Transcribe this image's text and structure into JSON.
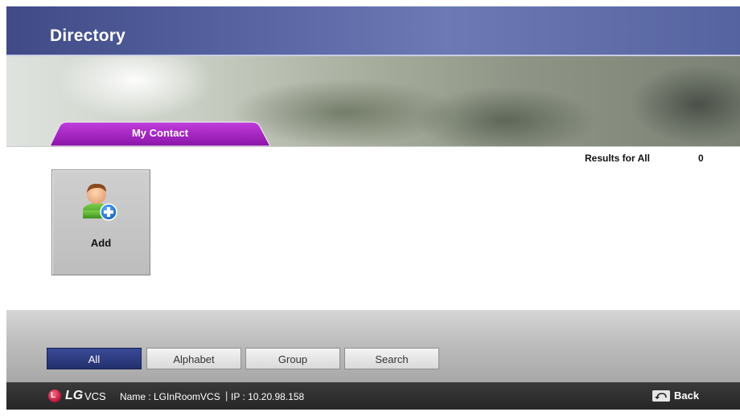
{
  "window": {
    "title": "Directory"
  },
  "tabs": [
    {
      "label": "My Contact",
      "active": true
    }
  ],
  "results": {
    "label": "Results for All",
    "count": "0"
  },
  "add_tile": {
    "label": "Add",
    "icon": "add-contact-icon"
  },
  "filters": [
    {
      "label": "All",
      "selected": true
    },
    {
      "label": "Alphabet",
      "selected": false
    },
    {
      "label": "Group",
      "selected": false
    },
    {
      "label": "Search",
      "selected": false
    }
  ],
  "status_bar": {
    "brand": "LG",
    "logo_letter": "L",
    "product": "VCS",
    "name": "Name : LGInRoomVCS",
    "separator": "|",
    "ip": "IP : 10.20.98.158",
    "back_label": "Back"
  },
  "colors": {
    "title_bar": "#4a5694",
    "tab_active": "#a21fc1",
    "filter_selected": "#2b3780",
    "status_bar": "#2e2e2e",
    "lg_red": "#c0123a"
  }
}
